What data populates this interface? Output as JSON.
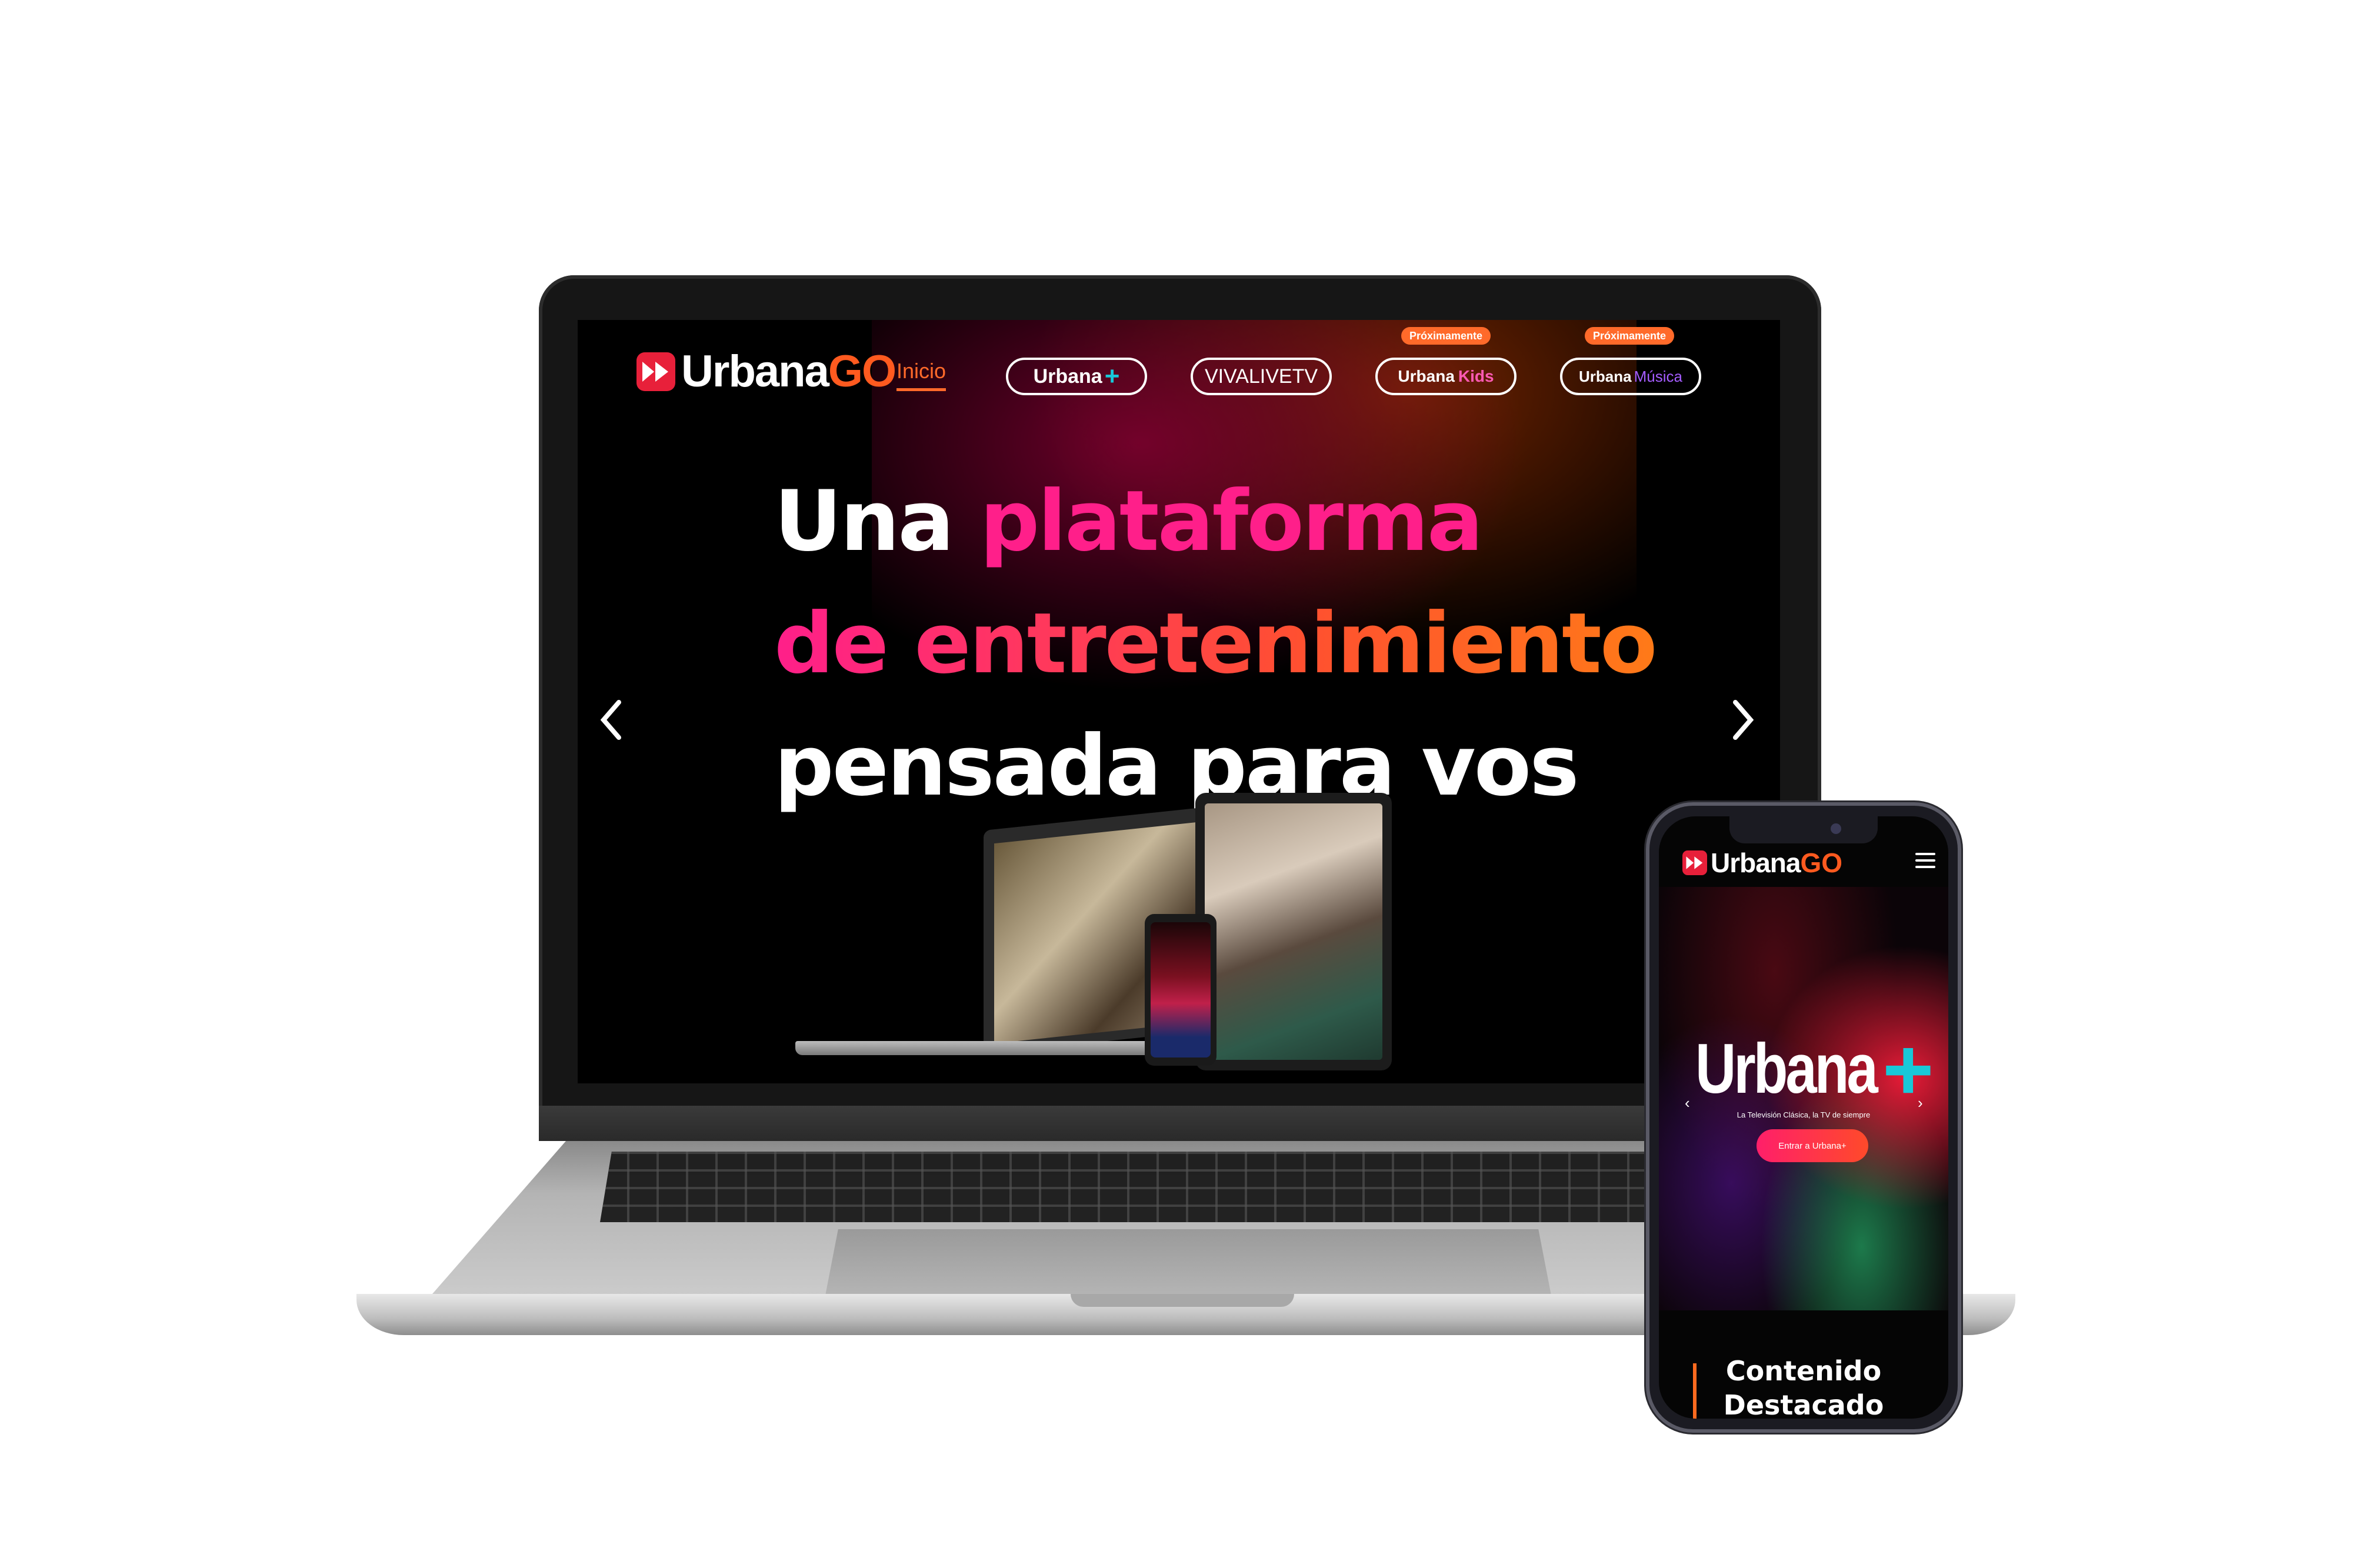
{
  "laptop": {
    "brand": {
      "name": "Urbana",
      "suffix": "GO"
    },
    "nav": {
      "inicio": "Inicio",
      "urbana_plus": {
        "label": "Urbana",
        "accent": "+"
      },
      "viva": {
        "label": "VIVALIVETV"
      },
      "kids": {
        "label": "Urbana",
        "accent": "Kids",
        "badge": "Próximamente"
      },
      "musica": {
        "label": "Urbana",
        "accent": "Música",
        "badge": "Próximamente"
      }
    },
    "hero": {
      "line1_a": "Una",
      "line1_b": "plataforma",
      "line2": "de entretenimiento",
      "line3": "pensada para vos"
    },
    "arrows": {
      "prev": "‹",
      "next": "›"
    }
  },
  "phone": {
    "brand": {
      "name": "Urbana",
      "suffix": "GO"
    },
    "hero": {
      "title": "Urbana",
      "title_accent": "+",
      "tagline": "La Televisión Clásica, la TV de siempre",
      "cta": "Entrar a Urbana+"
    },
    "section_title": "Contenido Destacado"
  },
  "colors": {
    "accent_orange": "#ff6a2a",
    "accent_pink": "#ff1f8a",
    "brand_red": "#e8203a",
    "plus_cyan": "#18c8d8"
  },
  "icons": {
    "logo": "play-forward-icon",
    "menu": "hamburger-menu-icon",
    "prev": "chevron-left-icon",
    "next": "chevron-right-icon"
  }
}
